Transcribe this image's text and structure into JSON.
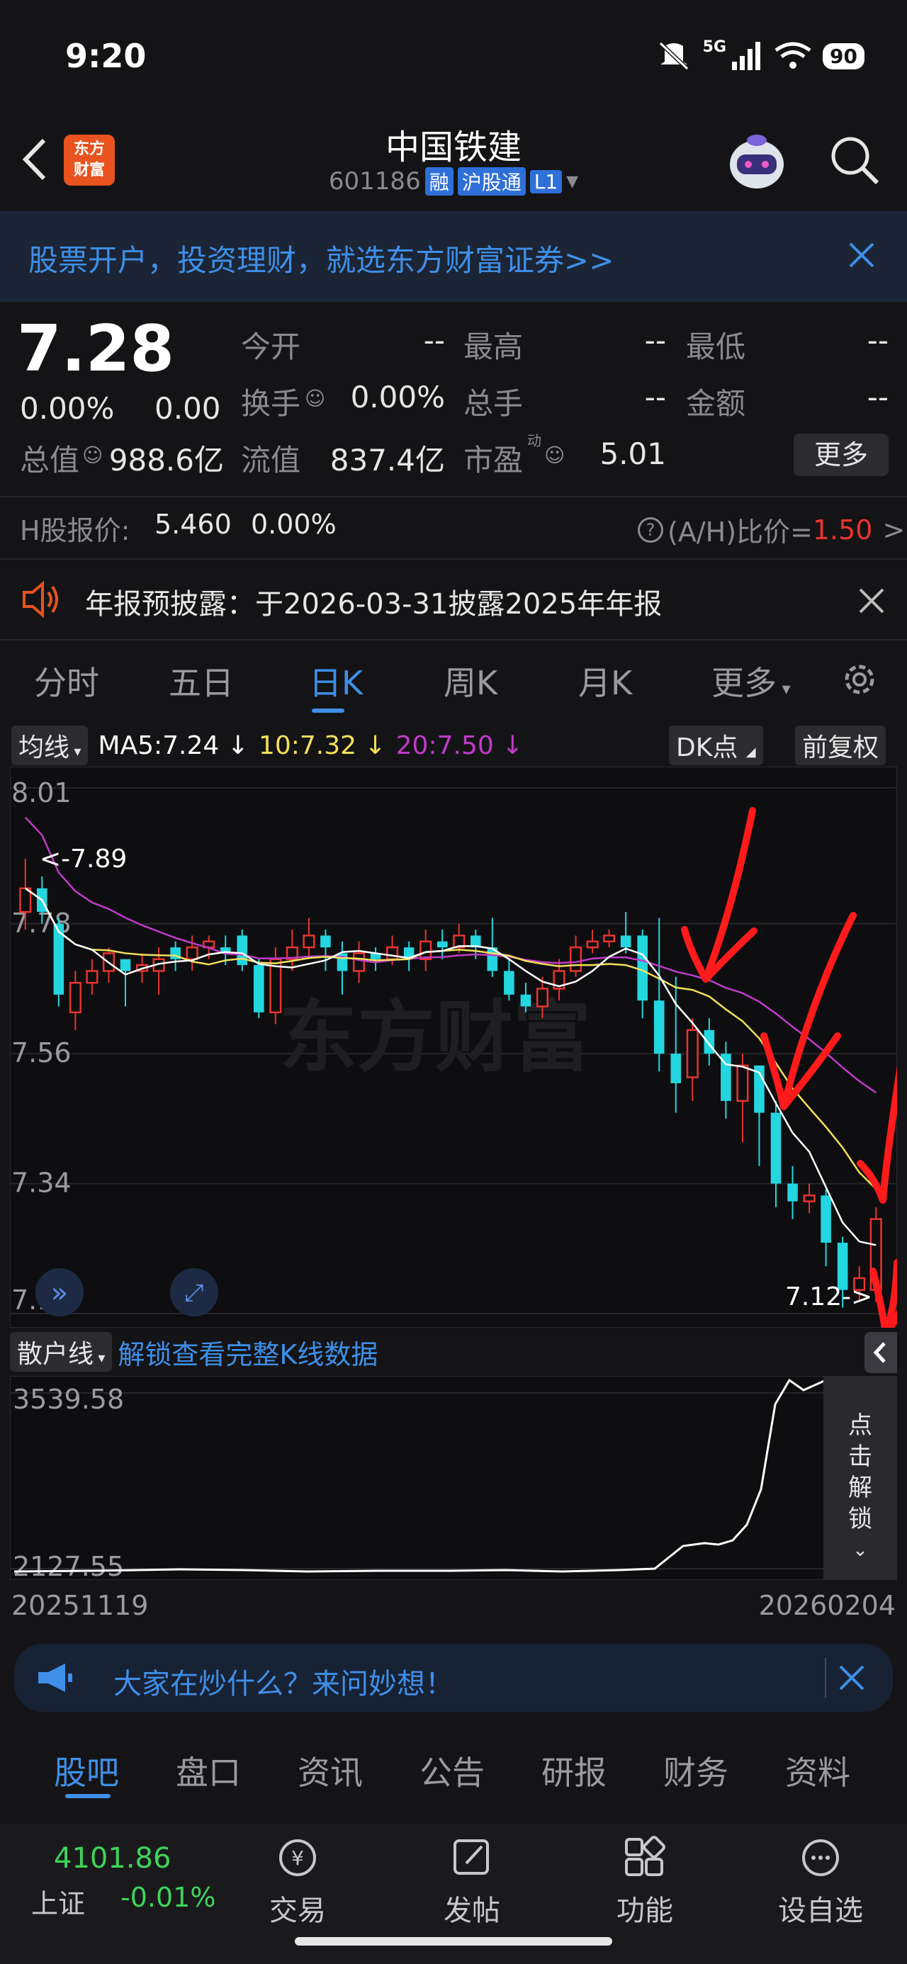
{
  "status": {
    "time": "9:20",
    "network": "5G",
    "battery": "90"
  },
  "header": {
    "stock_name": "中国铁建",
    "code": "601186",
    "tags": [
      "融",
      "沪股通",
      "L1"
    ],
    "logo_text": "东方财富"
  },
  "banner": {
    "text": "股票开户，投资理财，就选东方财富证券>>"
  },
  "quote": {
    "price": "7.28",
    "change_pct": "0.00%",
    "change": "0.00",
    "open_label": "今开",
    "open": "--",
    "high_label": "最高",
    "high": "--",
    "low_label": "最低",
    "low": "--",
    "turnover_label": "换手",
    "turnover": "0.00%",
    "volume_label": "总手",
    "volume": "--",
    "amount_label": "金额",
    "amount": "--",
    "mcap_label": "总值",
    "mcap": "988.6亿",
    "float_label": "流值",
    "float": "837.4亿",
    "pe_label": "市盈",
    "pe_sup": "动",
    "pe": "5.01",
    "more": "更多"
  },
  "hshare": {
    "label": "H股报价:",
    "price": "5.460",
    "pct": "0.00%",
    "ah_label": "(A/H)比价=",
    "ah_value": "1.50",
    "arrow": ">"
  },
  "notice": {
    "text": "年报预披露：于2026-03-31披露2025年年报"
  },
  "tabs": [
    "分时",
    "五日",
    "日K",
    "周K",
    "月K",
    "更多"
  ],
  "ma": {
    "selector": "均线",
    "ma5": "MA5:7.24",
    "ma10": "10:7.32",
    "ma20": "20:7.50",
    "arrow": "↓",
    "dk": "DK点",
    "adjust": "前复权"
  },
  "chart_data": {
    "type": "candlestick",
    "y_ticks": [
      "8.01",
      "7.78",
      "7.56",
      "7.34",
      "7.12"
    ],
    "ylim": [
      7.12,
      8.01
    ],
    "marker_high": "<-7.89",
    "marker_low": "7.12->",
    "x_start": "20251119",
    "x_end": "20260204",
    "watermark": "东方财富",
    "colors": {
      "up": "#e8342f",
      "down": "#23d6e0",
      "ma5": "#ffffff",
      "ma10": "#f2e05a",
      "ma20": "#c03bc9"
    },
    "candles": [
      [
        7.8,
        7.84,
        7.89,
        7.77
      ],
      [
        7.84,
        7.8,
        7.86,
        7.78
      ],
      [
        7.78,
        7.66,
        7.79,
        7.64
      ],
      [
        7.63,
        7.68,
        7.7,
        7.6
      ],
      [
        7.68,
        7.7,
        7.72,
        7.66
      ],
      [
        7.7,
        7.73,
        7.74,
        7.68
      ],
      [
        7.72,
        7.7,
        7.72,
        7.64
      ],
      [
        7.7,
        7.71,
        7.73,
        7.68
      ],
      [
        7.7,
        7.72,
        7.74,
        7.66
      ],
      [
        7.74,
        7.72,
        7.75,
        7.7
      ],
      [
        7.72,
        7.74,
        7.76,
        7.7
      ],
      [
        7.74,
        7.75,
        7.76,
        7.72
      ],
      [
        7.74,
        7.73,
        7.76,
        7.71
      ],
      [
        7.76,
        7.71,
        7.77,
        7.7
      ],
      [
        7.71,
        7.63,
        7.72,
        7.62
      ],
      [
        7.63,
        7.72,
        7.74,
        7.61
      ],
      [
        7.72,
        7.74,
        7.77,
        7.7
      ],
      [
        7.74,
        7.76,
        7.79,
        7.72
      ],
      [
        7.76,
        7.74,
        7.77,
        7.7
      ],
      [
        7.73,
        7.7,
        7.75,
        7.66
      ],
      [
        7.7,
        7.73,
        7.75,
        7.68
      ],
      [
        7.73,
        7.72,
        7.74,
        7.7
      ],
      [
        7.72,
        7.74,
        7.76,
        7.71
      ],
      [
        7.74,
        7.72,
        7.75,
        7.7
      ],
      [
        7.72,
        7.75,
        7.77,
        7.7
      ],
      [
        7.75,
        7.74,
        7.77,
        7.72
      ],
      [
        7.74,
        7.76,
        7.78,
        7.73
      ],
      [
        7.76,
        7.74,
        7.77,
        7.72
      ],
      [
        7.74,
        7.7,
        7.79,
        7.69
      ],
      [
        7.7,
        7.66,
        7.72,
        7.65
      ],
      [
        7.66,
        7.64,
        7.68,
        7.63
      ],
      [
        7.64,
        7.67,
        7.69,
        7.62
      ],
      [
        7.67,
        7.7,
        7.72,
        7.65
      ],
      [
        7.7,
        7.74,
        7.76,
        7.69
      ],
      [
        7.74,
        7.75,
        7.77,
        7.73
      ],
      [
        7.75,
        7.76,
        7.77,
        7.74
      ],
      [
        7.76,
        7.74,
        7.8,
        7.73
      ],
      [
        7.76,
        7.65,
        7.77,
        7.62
      ],
      [
        7.65,
        7.56,
        7.79,
        7.53
      ],
      [
        7.56,
        7.51,
        7.69,
        7.46
      ],
      [
        7.52,
        7.6,
        7.62,
        7.48
      ],
      [
        7.6,
        7.56,
        7.62,
        7.54
      ],
      [
        7.56,
        7.48,
        7.58,
        7.45
      ],
      [
        7.48,
        7.54,
        7.56,
        7.41
      ],
      [
        7.54,
        7.46,
        7.54,
        7.37
      ],
      [
        7.46,
        7.34,
        7.48,
        7.3
      ],
      [
        7.34,
        7.31,
        7.37,
        7.28
      ],
      [
        7.31,
        7.32,
        7.34,
        7.29
      ],
      [
        7.32,
        7.24,
        7.33,
        7.2
      ],
      [
        7.24,
        7.16,
        7.25,
        7.13
      ],
      [
        7.16,
        7.18,
        7.2,
        7.14
      ],
      [
        7.16,
        7.28,
        7.3,
        7.14
      ]
    ]
  },
  "indicator": {
    "name": "散户线",
    "unlock_text": "解锁查看完整K线数据",
    "y_top": "3539.58",
    "y_bottom": "2127.55",
    "side_unlock": [
      "点",
      "击",
      "解",
      "锁"
    ]
  },
  "ask": {
    "text": "大家在炒什么？来问妙想！"
  },
  "bottom_tabs": [
    "股吧",
    "盘口",
    "资讯",
    "公告",
    "研报",
    "财务",
    "资料"
  ],
  "nav": {
    "index_value": "4101.86",
    "index_name": "上证",
    "index_pct": "-0.01%",
    "items": [
      "交易",
      "发帖",
      "功能",
      "设自选"
    ]
  }
}
